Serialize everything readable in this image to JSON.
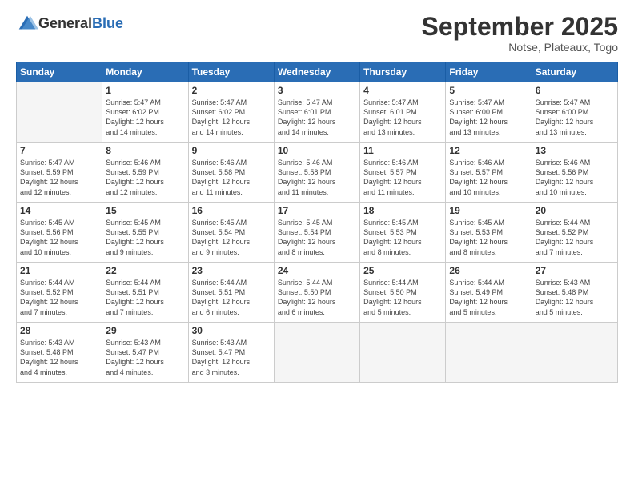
{
  "header": {
    "logo_general": "General",
    "logo_blue": "Blue",
    "month": "September 2025",
    "location": "Notse, Plateaux, Togo"
  },
  "days_of_week": [
    "Sunday",
    "Monday",
    "Tuesday",
    "Wednesday",
    "Thursday",
    "Friday",
    "Saturday"
  ],
  "weeks": [
    [
      {
        "day": "",
        "info": ""
      },
      {
        "day": "1",
        "info": "Sunrise: 5:47 AM\nSunset: 6:02 PM\nDaylight: 12 hours\nand 14 minutes."
      },
      {
        "day": "2",
        "info": "Sunrise: 5:47 AM\nSunset: 6:02 PM\nDaylight: 12 hours\nand 14 minutes."
      },
      {
        "day": "3",
        "info": "Sunrise: 5:47 AM\nSunset: 6:01 PM\nDaylight: 12 hours\nand 14 minutes."
      },
      {
        "day": "4",
        "info": "Sunrise: 5:47 AM\nSunset: 6:01 PM\nDaylight: 12 hours\nand 13 minutes."
      },
      {
        "day": "5",
        "info": "Sunrise: 5:47 AM\nSunset: 6:00 PM\nDaylight: 12 hours\nand 13 minutes."
      },
      {
        "day": "6",
        "info": "Sunrise: 5:47 AM\nSunset: 6:00 PM\nDaylight: 12 hours\nand 13 minutes."
      }
    ],
    [
      {
        "day": "7",
        "info": "Sunrise: 5:47 AM\nSunset: 5:59 PM\nDaylight: 12 hours\nand 12 minutes."
      },
      {
        "day": "8",
        "info": "Sunrise: 5:46 AM\nSunset: 5:59 PM\nDaylight: 12 hours\nand 12 minutes."
      },
      {
        "day": "9",
        "info": "Sunrise: 5:46 AM\nSunset: 5:58 PM\nDaylight: 12 hours\nand 11 minutes."
      },
      {
        "day": "10",
        "info": "Sunrise: 5:46 AM\nSunset: 5:58 PM\nDaylight: 12 hours\nand 11 minutes."
      },
      {
        "day": "11",
        "info": "Sunrise: 5:46 AM\nSunset: 5:57 PM\nDaylight: 12 hours\nand 11 minutes."
      },
      {
        "day": "12",
        "info": "Sunrise: 5:46 AM\nSunset: 5:57 PM\nDaylight: 12 hours\nand 10 minutes."
      },
      {
        "day": "13",
        "info": "Sunrise: 5:46 AM\nSunset: 5:56 PM\nDaylight: 12 hours\nand 10 minutes."
      }
    ],
    [
      {
        "day": "14",
        "info": "Sunrise: 5:45 AM\nSunset: 5:56 PM\nDaylight: 12 hours\nand 10 minutes."
      },
      {
        "day": "15",
        "info": "Sunrise: 5:45 AM\nSunset: 5:55 PM\nDaylight: 12 hours\nand 9 minutes."
      },
      {
        "day": "16",
        "info": "Sunrise: 5:45 AM\nSunset: 5:54 PM\nDaylight: 12 hours\nand 9 minutes."
      },
      {
        "day": "17",
        "info": "Sunrise: 5:45 AM\nSunset: 5:54 PM\nDaylight: 12 hours\nand 8 minutes."
      },
      {
        "day": "18",
        "info": "Sunrise: 5:45 AM\nSunset: 5:53 PM\nDaylight: 12 hours\nand 8 minutes."
      },
      {
        "day": "19",
        "info": "Sunrise: 5:45 AM\nSunset: 5:53 PM\nDaylight: 12 hours\nand 8 minutes."
      },
      {
        "day": "20",
        "info": "Sunrise: 5:44 AM\nSunset: 5:52 PM\nDaylight: 12 hours\nand 7 minutes."
      }
    ],
    [
      {
        "day": "21",
        "info": "Sunrise: 5:44 AM\nSunset: 5:52 PM\nDaylight: 12 hours\nand 7 minutes."
      },
      {
        "day": "22",
        "info": "Sunrise: 5:44 AM\nSunset: 5:51 PM\nDaylight: 12 hours\nand 7 minutes."
      },
      {
        "day": "23",
        "info": "Sunrise: 5:44 AM\nSunset: 5:51 PM\nDaylight: 12 hours\nand 6 minutes."
      },
      {
        "day": "24",
        "info": "Sunrise: 5:44 AM\nSunset: 5:50 PM\nDaylight: 12 hours\nand 6 minutes."
      },
      {
        "day": "25",
        "info": "Sunrise: 5:44 AM\nSunset: 5:50 PM\nDaylight: 12 hours\nand 5 minutes."
      },
      {
        "day": "26",
        "info": "Sunrise: 5:44 AM\nSunset: 5:49 PM\nDaylight: 12 hours\nand 5 minutes."
      },
      {
        "day": "27",
        "info": "Sunrise: 5:43 AM\nSunset: 5:48 PM\nDaylight: 12 hours\nand 5 minutes."
      }
    ],
    [
      {
        "day": "28",
        "info": "Sunrise: 5:43 AM\nSunset: 5:48 PM\nDaylight: 12 hours\nand 4 minutes."
      },
      {
        "day": "29",
        "info": "Sunrise: 5:43 AM\nSunset: 5:47 PM\nDaylight: 12 hours\nand 4 minutes."
      },
      {
        "day": "30",
        "info": "Sunrise: 5:43 AM\nSunset: 5:47 PM\nDaylight: 12 hours\nand 3 minutes."
      },
      {
        "day": "",
        "info": ""
      },
      {
        "day": "",
        "info": ""
      },
      {
        "day": "",
        "info": ""
      },
      {
        "day": "",
        "info": ""
      }
    ]
  ]
}
